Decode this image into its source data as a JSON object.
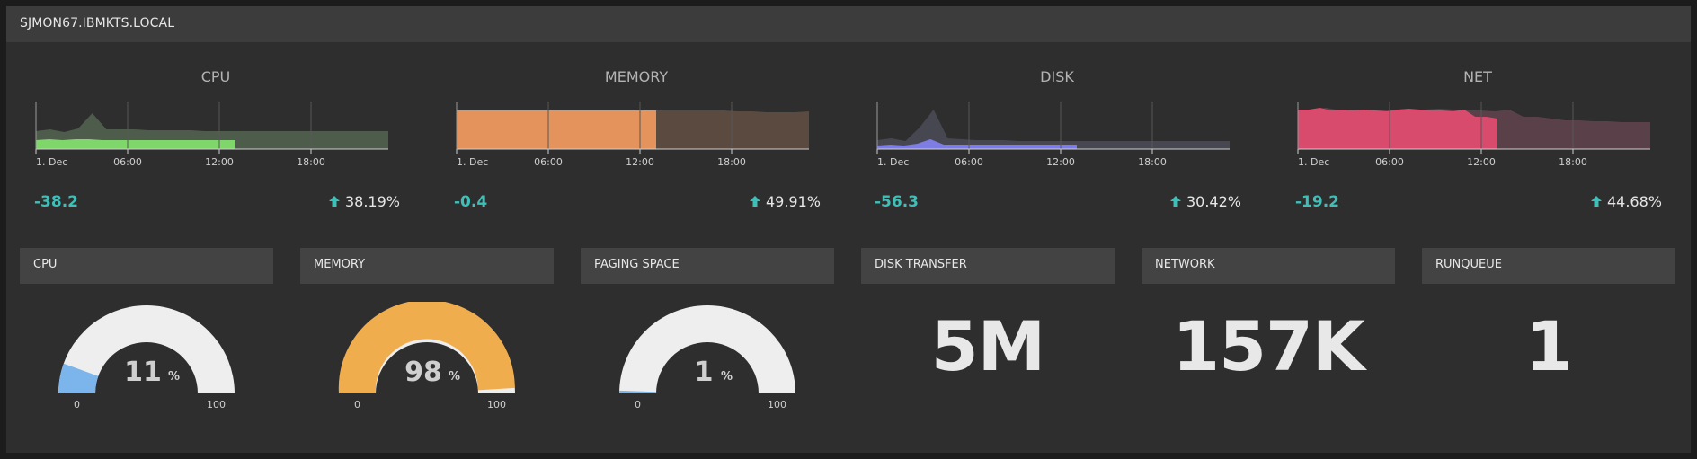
{
  "header": {
    "title": "SJMON67.IBMKTS.LOCAL"
  },
  "charts": [
    {
      "title": "CPU",
      "change": "-38.2",
      "percent": "38.19%",
      "color": "#7fd66b",
      "color_past": "#4d5c4b",
      "ticks": [
        "1. Dec",
        "06:00",
        "12:00",
        "18:00"
      ]
    },
    {
      "title": "MEMORY",
      "change": "-0.4",
      "percent": "49.91%",
      "color": "#e3935b",
      "color_past": "#5b4a40",
      "ticks": [
        "1. Dec",
        "06:00",
        "12:00",
        "18:00"
      ]
    },
    {
      "title": "DISK",
      "change": "-56.3",
      "percent": "30.42%",
      "color": "#7d7de3",
      "color_past": "#474752",
      "ticks": [
        "1. Dec",
        "06:00",
        "12:00",
        "18:00"
      ]
    },
    {
      "title": "NET",
      "change": "-19.2",
      "percent": "44.68%",
      "color": "#d94b6c",
      "color_past": "#5a4048",
      "ticks": [
        "1. Dec",
        "06:00",
        "12:00",
        "18:00"
      ]
    }
  ],
  "boxes": [
    {
      "title": "CPU",
      "kind": "gauge",
      "value": 11,
      "unit": "%",
      "min": "0",
      "max": "100",
      "fill": "#7cb5ec"
    },
    {
      "title": "MEMORY",
      "kind": "gauge",
      "value": 98,
      "unit": "%",
      "min": "0",
      "max": "100",
      "fill": "#f0ad4e"
    },
    {
      "title": "PAGING SPACE",
      "kind": "gauge",
      "value": 1,
      "unit": "%",
      "min": "0",
      "max": "100",
      "fill": "#7cb5ec"
    },
    {
      "title": "DISK TRANSFER",
      "kind": "number",
      "display": "5M"
    },
    {
      "title": "NETWORK",
      "kind": "number",
      "display": "157K"
    },
    {
      "title": "RUNQUEUE",
      "kind": "number",
      "display": "1"
    }
  ],
  "colors": {
    "accent": "#3fbfb7",
    "gauge_track": "#eeeeee"
  }
}
